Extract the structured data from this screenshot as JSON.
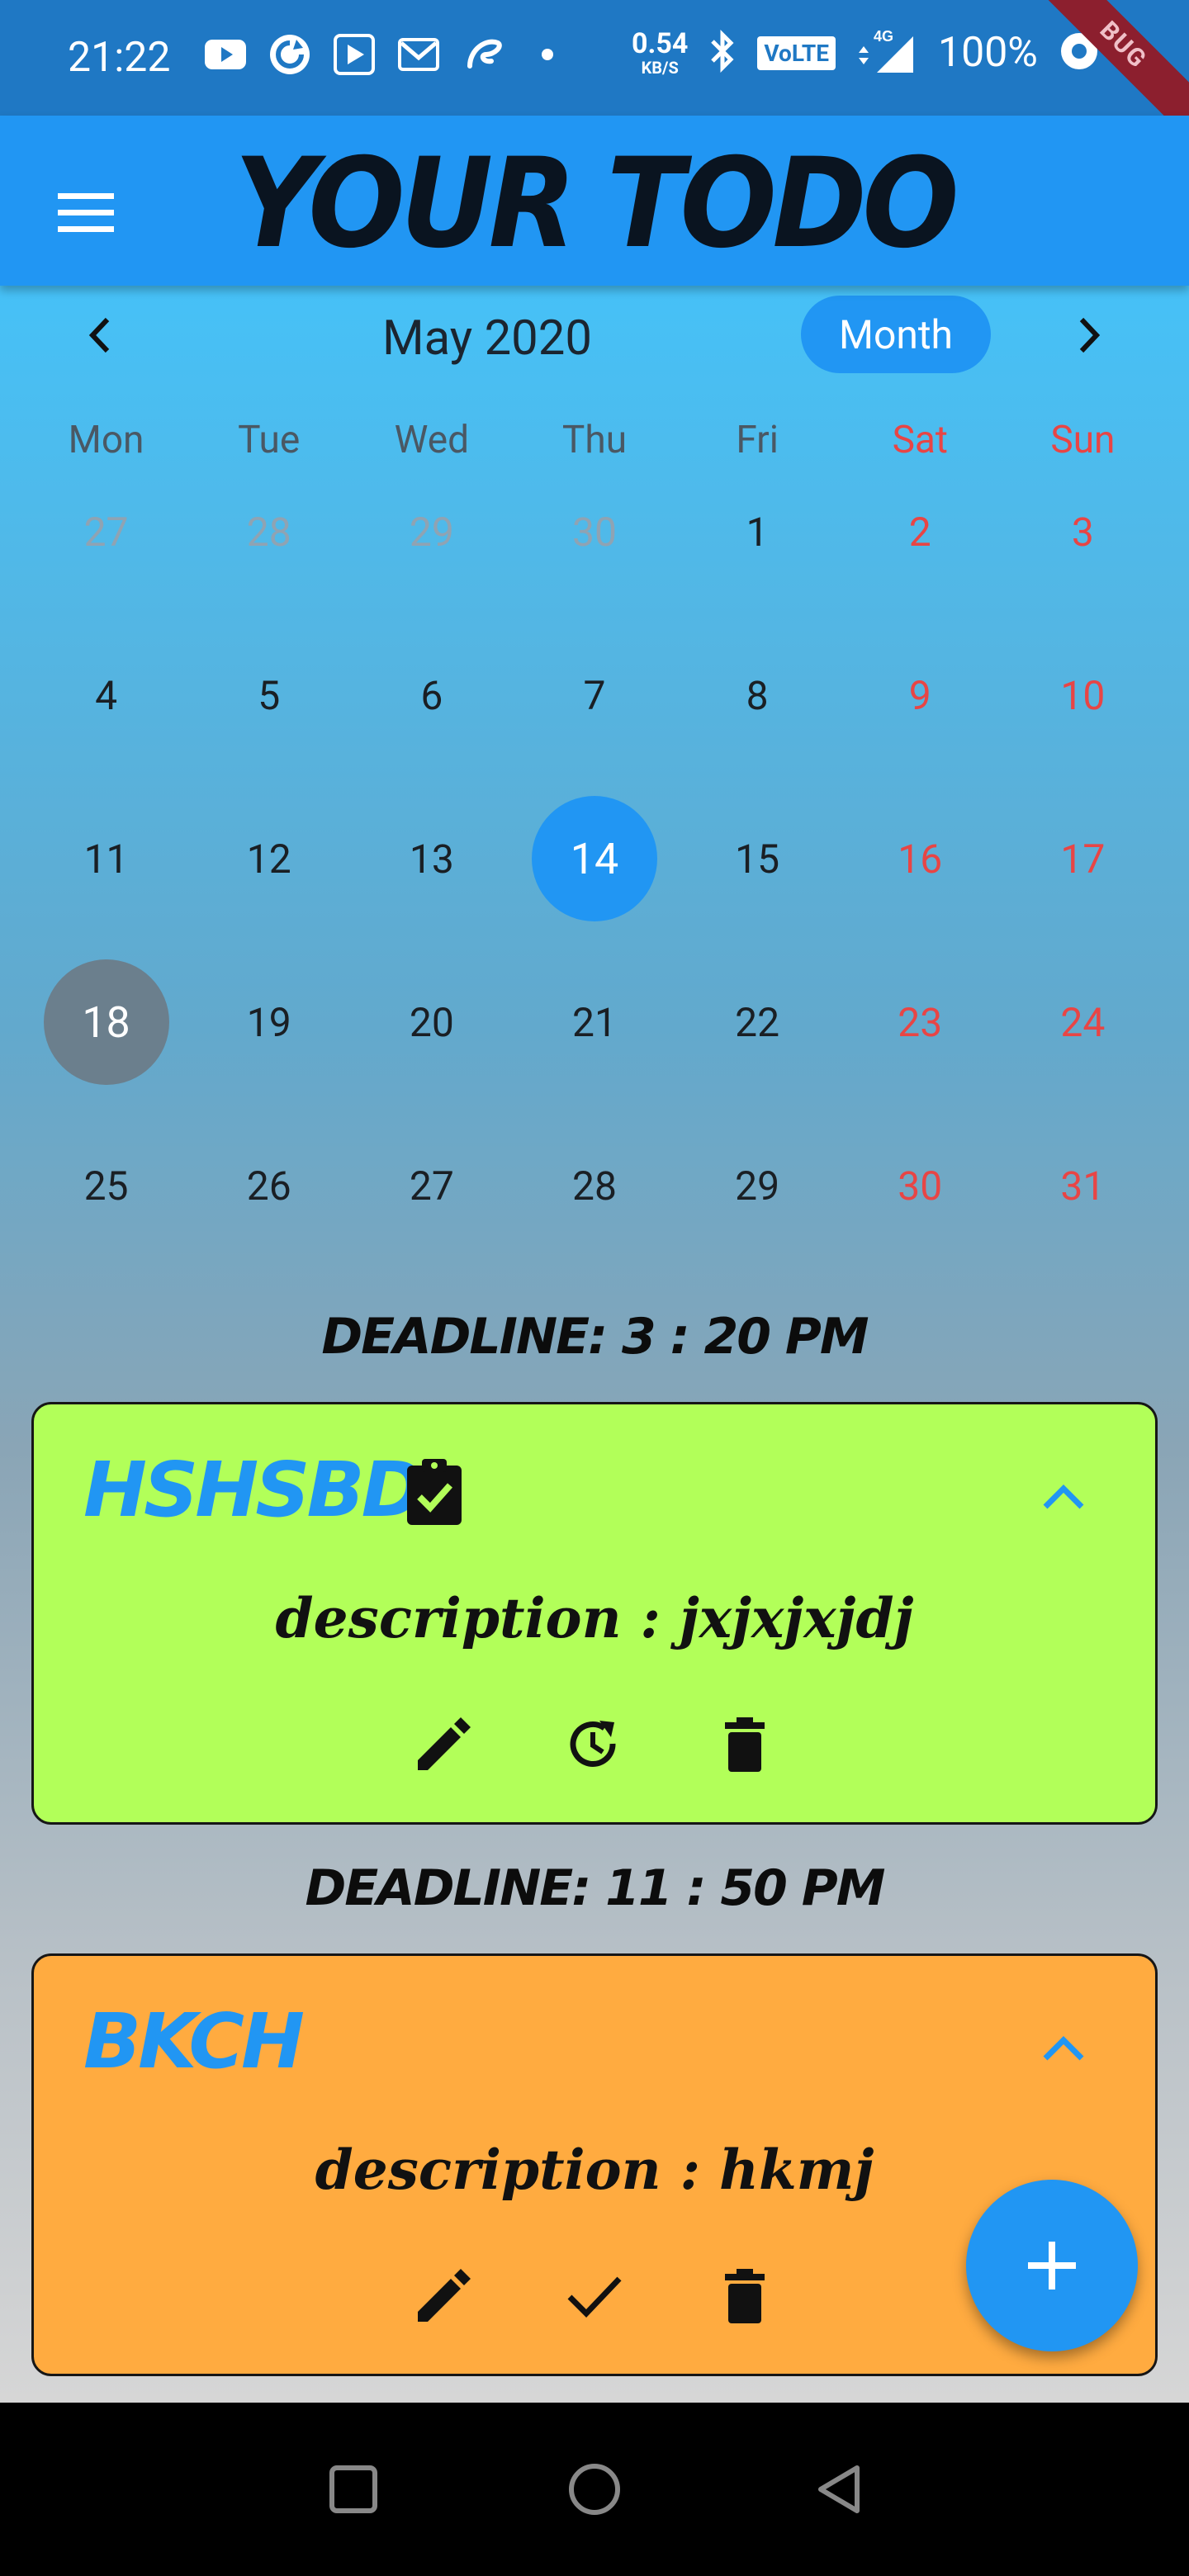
{
  "status_bar": {
    "time": "21:22",
    "net_speed_value": "0.54",
    "net_speed_unit": "KB/S",
    "volte": "VoLTE",
    "network": "4G",
    "battery": "100%",
    "debug_label": "BUG"
  },
  "app_bar": {
    "title": "YOUR TODO",
    "menu_icon": "menu-icon"
  },
  "calendar": {
    "title": "May 2020",
    "format_button": "Month",
    "weekdays": [
      "Mon",
      "Tue",
      "Wed",
      "Thu",
      "Fri",
      "Sat",
      "Sun"
    ],
    "weeks": [
      [
        "27",
        "28",
        "29",
        "30",
        "1",
        "2",
        "3"
      ],
      [
        "4",
        "5",
        "6",
        "7",
        "8",
        "9",
        "10"
      ],
      [
        "11",
        "12",
        "13",
        "14",
        "15",
        "16",
        "17"
      ],
      [
        "18",
        "19",
        "20",
        "21",
        "22",
        "23",
        "24"
      ],
      [
        "25",
        "26",
        "27",
        "28",
        "29",
        "30",
        "31"
      ]
    ],
    "selected_day": "14",
    "today": "18",
    "accent": "#2196f3",
    "weekend_color": "#e84545"
  },
  "tasks": [
    {
      "deadline": "DEADLINE: 3 : 20 PM",
      "title": "HSHSBD",
      "description": "description : jxjxjxjdj",
      "color": "#b2ff59",
      "completed": true,
      "status_icon": "clipboard-check-icon",
      "actions": [
        "edit-icon",
        "restore-icon",
        "delete-icon"
      ]
    },
    {
      "deadline": "DEADLINE: 11 : 50 PM",
      "title": "BKCH",
      "description": "description : hkmj",
      "color": "#ffab40",
      "completed": false,
      "actions": [
        "edit-icon",
        "check-icon",
        "delete-icon"
      ]
    }
  ],
  "fab": {
    "icon": "add-icon"
  }
}
